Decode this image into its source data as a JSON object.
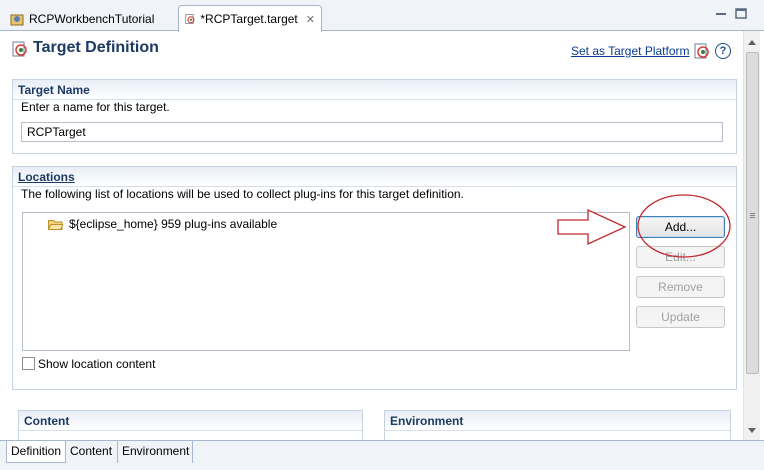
{
  "tabs": [
    {
      "label": "RCPWorkbenchTutorial"
    },
    {
      "label": "*RCPTarget.target",
      "close": "✕"
    }
  ],
  "header": {
    "title": "Target Definition",
    "set_target_link": "Set as Target Platform",
    "help_glyph": "?"
  },
  "target_name": {
    "heading": "Target Name",
    "description": "Enter a name for this target.",
    "value": "RCPTarget"
  },
  "locations": {
    "heading": "Locations",
    "description": "The following list of locations will be used to collect plug-ins for this target definition.",
    "items": [
      {
        "label": "${eclipse_home} 959 plug-ins available"
      }
    ],
    "buttons": {
      "add": "Add...",
      "edit": "Edit...",
      "remove": "Remove",
      "update": "Update"
    },
    "show_content_label": "Show location content"
  },
  "content_section": {
    "heading": "Content"
  },
  "environment_section": {
    "heading": "Environment"
  },
  "page_tabs": [
    {
      "label": "Definition"
    },
    {
      "label": "Content"
    },
    {
      "label": "Environment"
    }
  ],
  "colors": {
    "section_title": "#1b3a64",
    "link": "#0a3d91",
    "annotation": "#c0282e"
  },
  "icons": {
    "java_project_tab": "java-project-icon",
    "target_file_tab": "target-file-icon",
    "target_title": "target-definition-icon",
    "folder": "folder-icon",
    "help": "help-icon"
  }
}
